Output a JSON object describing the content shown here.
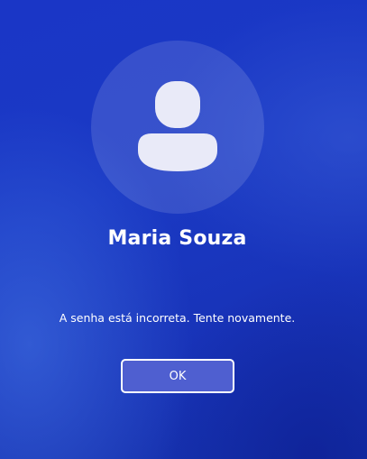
{
  "user": {
    "name": "Maria Souza",
    "avatar_icon": "user-placeholder-icon"
  },
  "login": {
    "error_message": "A senha está incorreta. Tente novamente.",
    "ok_label": "OK"
  },
  "colors": {
    "background": "#1a36c6",
    "avatar_fill": "#e9eaf8",
    "button_fill": "#4f5fd0",
    "text": "#ffffff"
  }
}
